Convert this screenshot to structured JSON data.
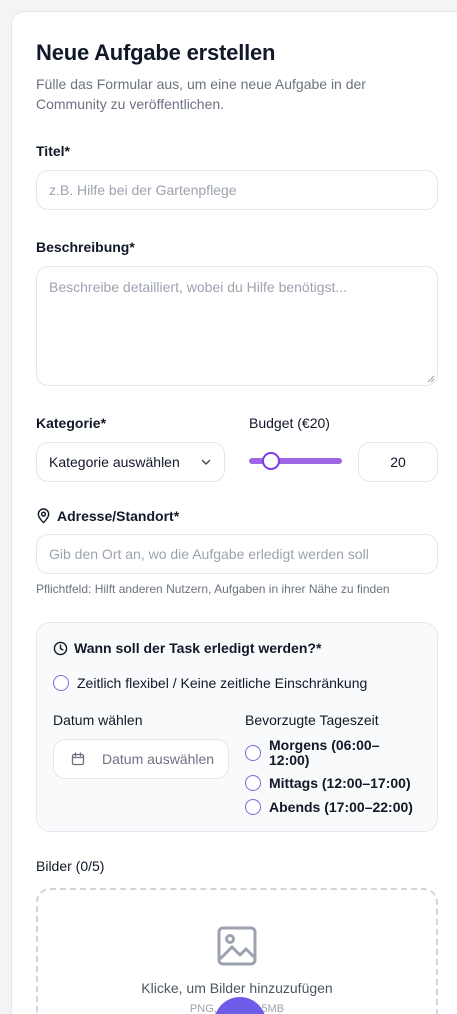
{
  "form": {
    "title": "Neue Aufgabe erstellen",
    "subtitle": "Fülle das Formular aus, um eine neue Aufgabe in der Community zu veröffentlichen."
  },
  "fields": {
    "title_label": "Titel*",
    "title_placeholder": "z.B. Hilfe bei der Gartenpflege",
    "description_label": "Beschreibung*",
    "description_placeholder": "Beschreibe detailliert, wobei du Hilfe benötigst...",
    "category_label": "Kategorie*",
    "category_value": "Kategorie auswählen",
    "budget_label": "Budget (€20)",
    "budget_value": "20",
    "budget_slider_fraction": 0.2,
    "address_label": "Adresse/Standort*",
    "address_placeholder": "Gib den Ort an, wo die Aufgabe erledigt werden soll",
    "address_hint": "Pflichtfeld: Hilft anderen Nutzern, Aufgaben in ihrer Nähe zu finden"
  },
  "schedule": {
    "heading": "Wann soll der Task erledigt werden?*",
    "flexible_option": "Zeitlich flexibel / Keine zeitliche Einschränkung",
    "date_label": "Datum wählen",
    "date_placeholder": "Datum auswählen",
    "time_label": "Bevorzugte Tageszeit",
    "time_options": [
      "Morgens (06:00–12:00)",
      "Mittags (12:00–17:00)",
      "Abends (17:00–22:00)"
    ]
  },
  "images": {
    "label": "Bilder (0/5)",
    "upload_text": "Klicke, um Bilder hinzuzufügen",
    "upload_sub": "PNG, JPG bis 5MB"
  },
  "colors": {
    "accent": "#7c3aed",
    "slider": "#9f67e4",
    "fab": "#6d5ce8"
  },
  "icons": {
    "address": "map-pin-icon",
    "schedule": "clock-icon",
    "date": "calendar-icon",
    "category": "chevron-down-icon",
    "upload": "image-icon"
  }
}
